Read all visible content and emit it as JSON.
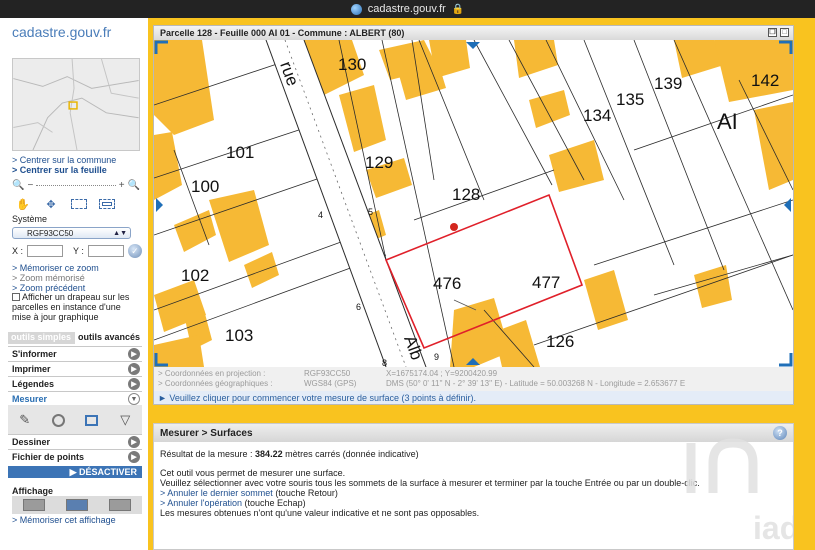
{
  "browser": {
    "url": "cadastre.gouv.fr"
  },
  "logo": "cadastre.gouv.fr",
  "nav": {
    "center_commune": "> Centrer sur la commune",
    "center_feuille": "> Centrer sur la feuille"
  },
  "zoom_controls": {
    "minus": "−",
    "plus": "+"
  },
  "systeme": {
    "label": "Système",
    "value": "RGF93CC50"
  },
  "xy": {
    "x_label": "X :",
    "y_label": "Y :"
  },
  "zoom_links": {
    "memoriser": "> Mémoriser ce zoom",
    "memorise": "> Zoom mémorisé",
    "precedent": "> Zoom précédent"
  },
  "flag_checkbox": "Afficher un drapeau sur les parcelles en instance d'une mise à jour graphique",
  "tabs": {
    "simple": "outils simples",
    "advanced": "outils avancés"
  },
  "menu": {
    "informer": "S'informer",
    "imprimer": "Imprimer",
    "legendes": "Légendes",
    "mesurer": "Mesurer",
    "dessiner": "Dessiner",
    "fichier": "Fichier de points"
  },
  "desactiver": "DÉSACTIVER",
  "affichage": {
    "title": "Affichage",
    "memo": "> Mémoriser cet affichage"
  },
  "window": {
    "title": "Parcelle 128 - Feuille 000 AI 01 - Commune : ALBERT (80)"
  },
  "map": {
    "parcels": [
      "130",
      "139",
      "142",
      "134",
      "135",
      "AI",
      "101",
      "129",
      "128",
      "100",
      "102",
      "476",
      "477",
      "103",
      "126"
    ],
    "street_words": [
      "rue",
      "Alb"
    ],
    "street_numbers": [
      "4",
      "5",
      "6",
      "8",
      "9"
    ]
  },
  "coords": {
    "proj_label": "> Coordonnées en projection :",
    "proj_system": "RGF93CC50",
    "proj_values": "X=1675174.04 ; Y=9200420.99",
    "geo_label": "> Coordonnées géographiques :",
    "geo_system": "WGS84 (GPS)",
    "geo_values": "DMS (50° 0' 11'' N - 2° 39' 13'' E) - Latitude = 50.003268 N - Longitude = 2.653677 E"
  },
  "status": "► Veuillez cliquer pour commencer votre mesure de surface (3 points à définir).",
  "surfaces": {
    "title": "Mesurer > Surfaces",
    "result_prefix": "Résultat de la mesure : ",
    "result_value": "384.22",
    "result_suffix": " mètres carrés (donnée indicative)",
    "line1": "Cet outil vous permet de mesurer une surface.",
    "line2": "Veuillez sélectionner avec votre souris tous les sommets de la surface à mesurer et terminer par la touche Entrée ou par un double-clic.",
    "undo_last": "> Annuler le dernier sommet",
    "undo_last_key": " (touche Retour)",
    "undo_op": "> Annuler l'opération",
    "undo_op_key": " (touche Echap)",
    "note": "Les mesures obtenues n'ont qu'une valeur indicative et ne sont pas opposables."
  },
  "watermark": "iad",
  "colors": {
    "frame": "#f9c31f",
    "building": "#f6b935",
    "selection": "#e0202a",
    "link": "#1f4f8f",
    "accent": "#3c74b6"
  }
}
